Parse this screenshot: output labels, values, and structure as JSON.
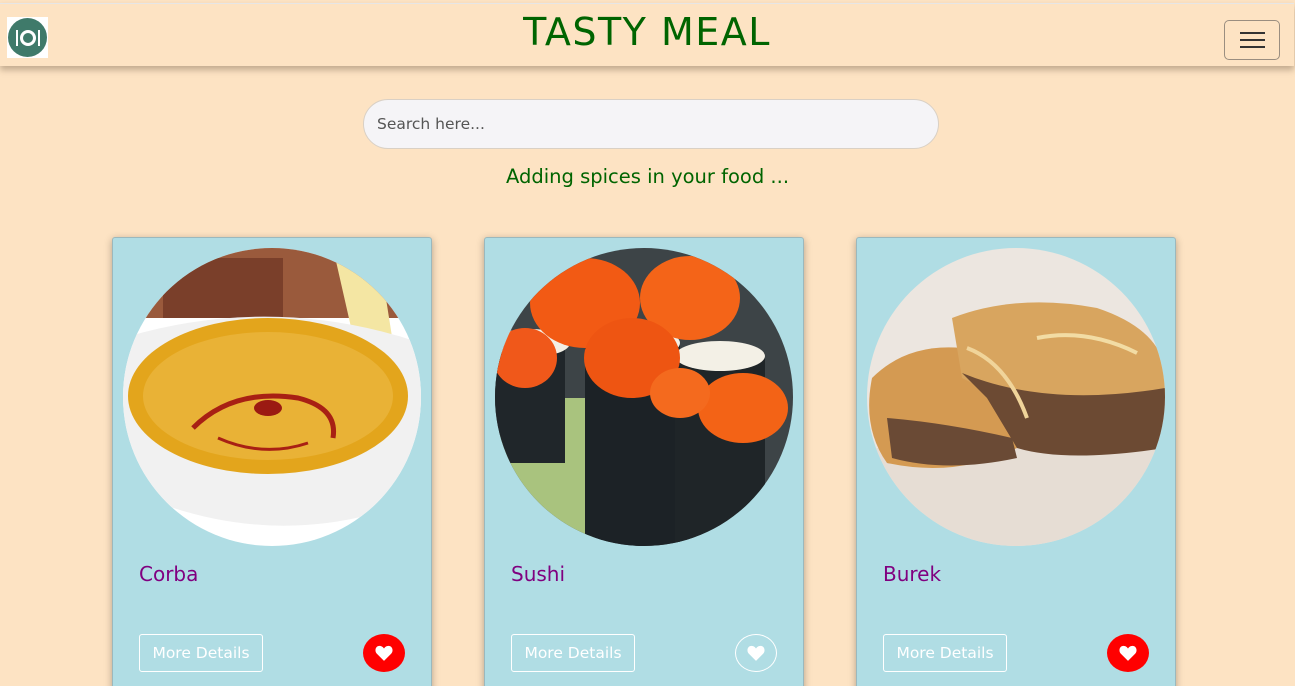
{
  "navbar": {
    "brand": "TASTY MEAL",
    "logo_icon": "plate-cutlery-icon",
    "menu_icon": "hamburger-menu-icon"
  },
  "search": {
    "placeholder": "Search here...",
    "value": ""
  },
  "tagline": "Adding spices in your food ...",
  "cards": [
    {
      "title": "Corba",
      "details_label": "More Details",
      "favorited": true,
      "image": "lentil-soup-bowl"
    },
    {
      "title": "Sushi",
      "details_label": "More Details",
      "favorited": false,
      "image": "sushi-rolls-with-roe"
    },
    {
      "title": "Burek",
      "details_label": "More Details",
      "favorited": true,
      "image": "meat-pastry"
    }
  ],
  "colors": {
    "background": "#fde3c3",
    "brand": "#006400",
    "card": "#b0dde4",
    "card_title": "#800080",
    "favorite": "#ff0000"
  }
}
